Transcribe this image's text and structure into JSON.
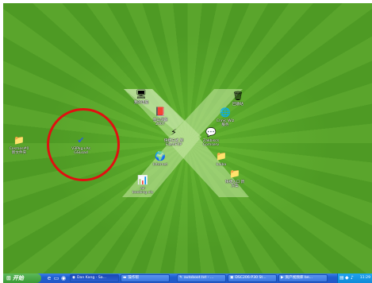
{
  "desktop": {
    "icons": [
      {
        "id": "my-computer",
        "label": "我的电脑",
        "icon": "computer-icon"
      },
      {
        "id": "recycle-bin",
        "label": "回收站",
        "icon": "recycle-bin-icon"
      },
      {
        "id": "jinshan",
        "label": "金山词霸\n2007",
        "icon": "dictionary-icon"
      },
      {
        "id": "cnnic",
        "label": "Cnnic Wiz\n服务",
        "icon": "globe-icon"
      },
      {
        "id": "flashfxp",
        "label": "快捷方式 到\nFlashFXP",
        "icon": "flashfxp-icon"
      },
      {
        "id": "zhejiang",
        "label": "Zakbiscs\nComserv",
        "icon": "chat-icon"
      },
      {
        "id": "kaiba",
        "label": "kaiba",
        "icon": "folder-icon"
      },
      {
        "id": "ie",
        "label": "Internet",
        "icon": "internet-explorer-icon"
      },
      {
        "id": "xinjian",
        "label": "快捷入口 新\n方案",
        "icon": "folder-icon"
      },
      {
        "id": "air-booking",
        "label": "air\nbooking.xls",
        "icon": "excel-file-icon"
      },
      {
        "id": "cosmoscap",
        "label": "V3Pkg+As\nGSLoad",
        "icon": "cosmos-app-icon"
      },
      {
        "id": "left-folder",
        "label": "Cosmos#0\n新文件夹",
        "icon": "folder-icon"
      }
    ]
  },
  "taskbar": {
    "start_label": "开始",
    "quick_launch": [
      "ie-quick-icon",
      "desktop-quick-icon",
      "media-quick-icon"
    ],
    "tasks": [
      {
        "label": "Dan Kang - Sa...",
        "icon": "browser-icon"
      },
      {
        "label": "操作帮",
        "icon": "folder-icon"
      },
      {
        "label": "autoboot.txt - ...",
        "icon": "notepad-icon"
      },
      {
        "label": "DSC206-P30 St...",
        "icon": "image-icon"
      },
      {
        "label": "资产视频库 be...",
        "icon": "video-icon"
      }
    ],
    "clock": "11:29"
  },
  "colors": {
    "accent": "#2358c8",
    "highlight": "#e01010",
    "desktop_green": "#4e9a24"
  }
}
